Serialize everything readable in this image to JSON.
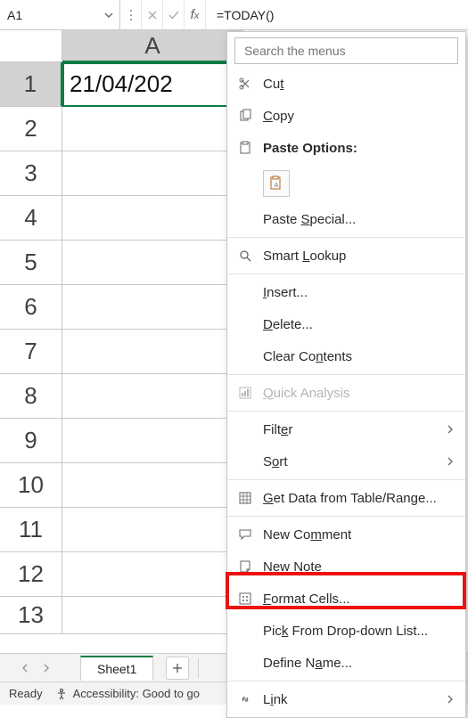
{
  "name_box": {
    "value": "A1"
  },
  "formula_bar": {
    "value": "=TODAY()"
  },
  "grid": {
    "columns": [
      "A"
    ],
    "rows": [
      "1",
      "2",
      "3",
      "4",
      "5",
      "6",
      "7",
      "8",
      "9",
      "10",
      "11",
      "12",
      "13"
    ],
    "active_cell_value": "21/04/202"
  },
  "context_menu": {
    "search_placeholder": "Search the menus",
    "items": {
      "cut": "Cut",
      "copy": "Copy",
      "paste_options": "Paste Options:",
      "paste_special": "Paste Special...",
      "smart_lookup": "Smart Lookup",
      "insert": "Insert...",
      "delete": "Delete...",
      "clear_contents": "Clear Contents",
      "quick_analysis": "Quick Analysis",
      "filter": "Filter",
      "sort": "Sort",
      "get_data": "Get Data from Table/Range...",
      "new_comment": "New Comment",
      "new_note": "New Note",
      "format_cells": "Format Cells...",
      "pick_list": "Pick From Drop-down List...",
      "define_name": "Define Name...",
      "link": "Link"
    }
  },
  "tabs": {
    "sheet1": "Sheet1"
  },
  "status": {
    "ready": "Ready",
    "accessibility": "Accessibility: Good to go"
  }
}
